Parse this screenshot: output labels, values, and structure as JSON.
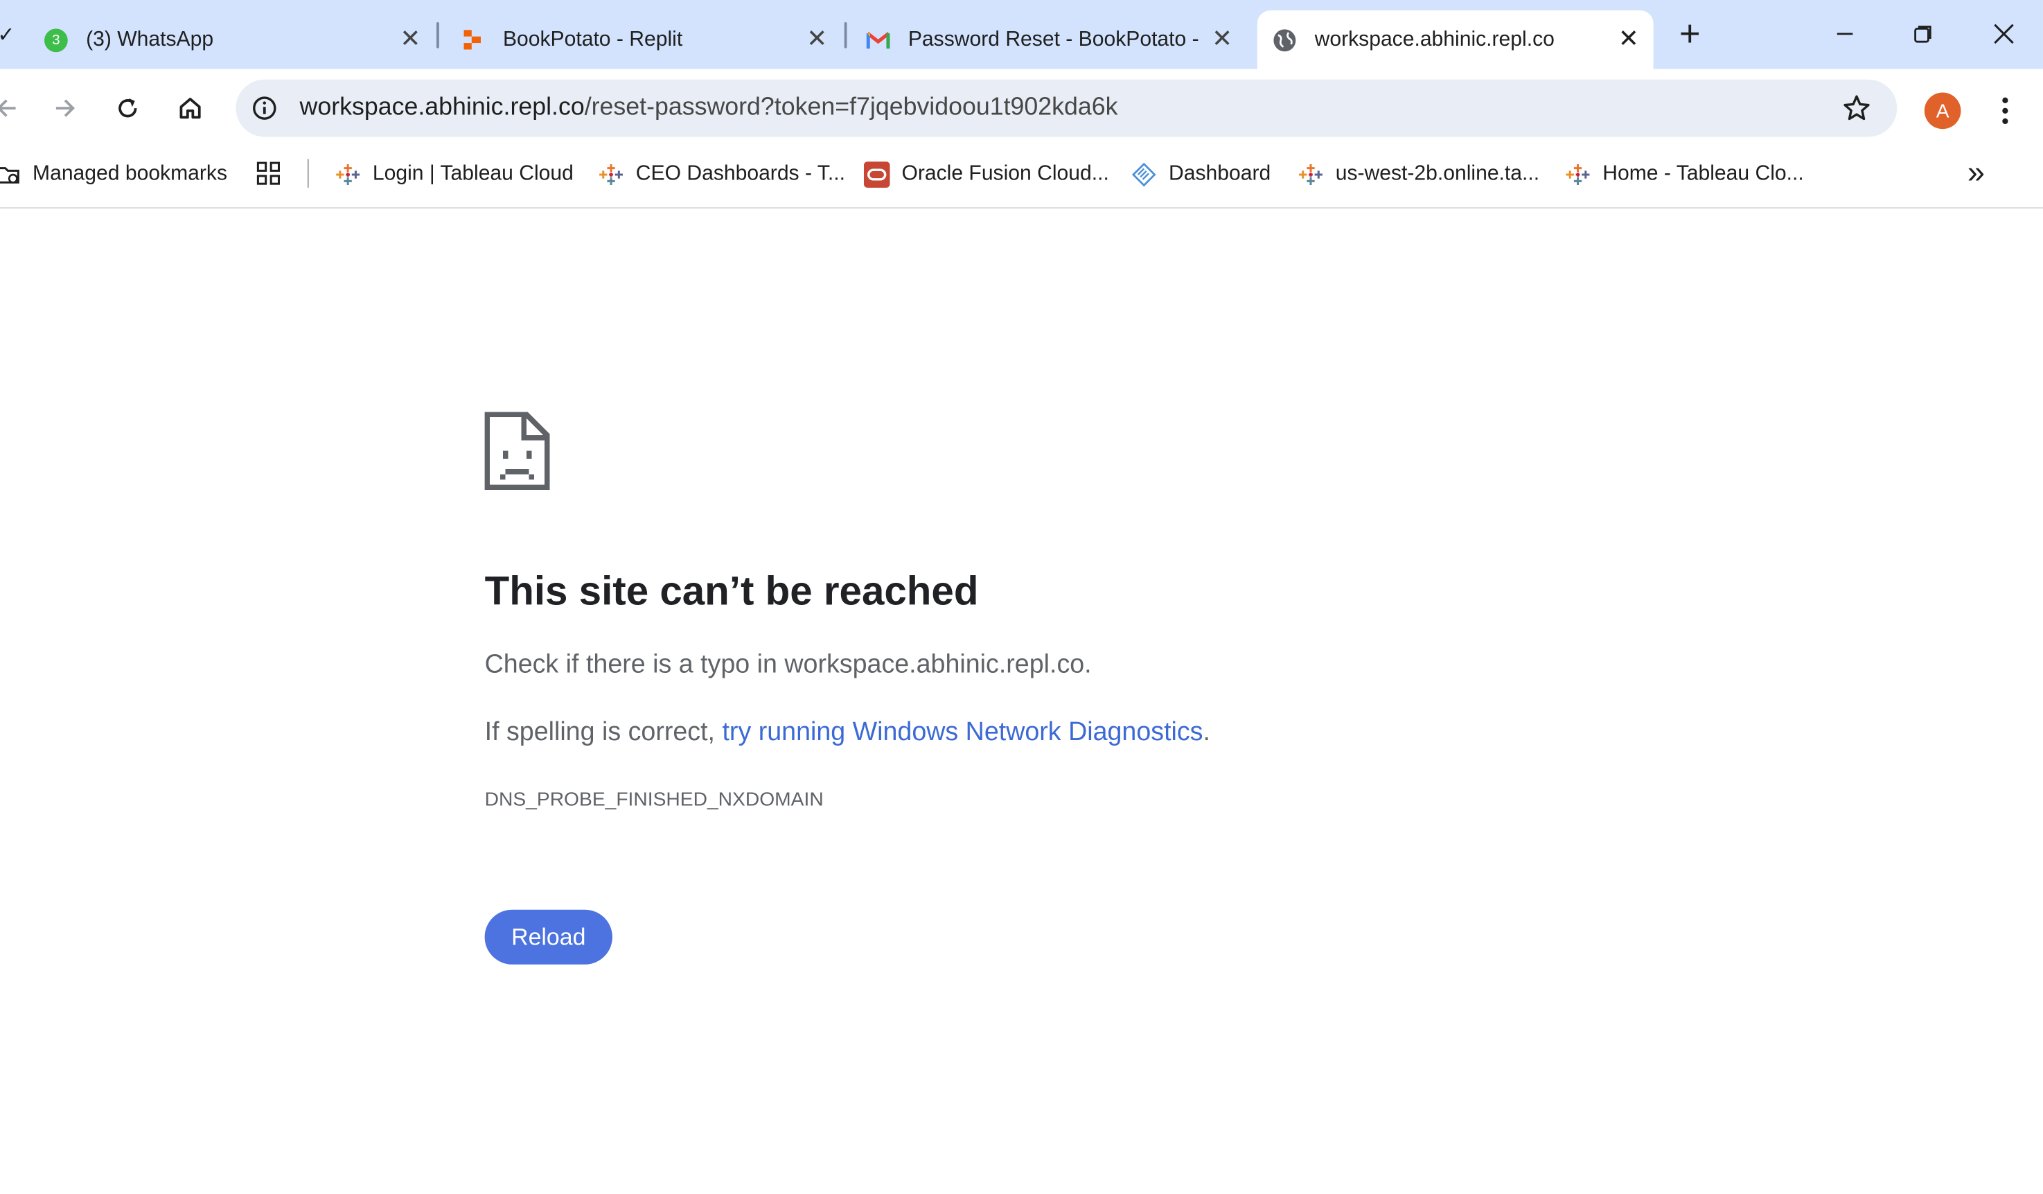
{
  "tabs": [
    {
      "title": "(3) WhatsApp",
      "badge": "3",
      "icon": "whatsapp-icon",
      "active": false
    },
    {
      "title": "BookPotato - Replit",
      "icon": "replit-icon",
      "active": false
    },
    {
      "title": "Password Reset - BookPotato -",
      "icon": "gmail-icon",
      "active": false
    },
    {
      "title": "workspace.abhinic.repl.co",
      "icon": "globe-icon",
      "active": true
    }
  ],
  "tab_close_glyph": "✕",
  "new_tab_glyph": "+",
  "window_controls": {
    "minimize": "minimize-icon",
    "restore": "restore-icon",
    "close": "close-icon"
  },
  "omnibox": {
    "host": "workspace.abhinic.repl.co",
    "path": "/reset-password?token=f7jqebvidoou1t902kda6k"
  },
  "profile": {
    "initial": "A",
    "color": "#e0622a"
  },
  "bookmarks": [
    {
      "label": "Managed bookmarks",
      "icon": "managed-bookmarks-icon"
    },
    {
      "label": "Login | Tableau Cloud",
      "icon": "tableau-icon"
    },
    {
      "label": "CEO Dashboards - T...",
      "icon": "tableau-icon"
    },
    {
      "label": "Oracle Fusion Cloud...",
      "icon": "oracle-icon"
    },
    {
      "label": "Dashboard",
      "icon": "dashboard-icon"
    },
    {
      "label": "us-west-2b.online.ta...",
      "icon": "tableau-icon"
    },
    {
      "label": "Home - Tableau Clo...",
      "icon": "tableau-icon"
    }
  ],
  "overflow_glyph": "»",
  "error": {
    "title": "This site can’t be reached",
    "line1": "Check if there is a typo in workspace.abhinic.repl.co.",
    "line2_prefix": "If spelling is correct, ",
    "line2_link": "try running Windows Network Diagnostics",
    "line2_suffix": ".",
    "code": "DNS_PROBE_FINISHED_NXDOMAIN",
    "reload_label": "Reload"
  },
  "colors": {
    "tabstrip": "#d3e3fd",
    "link": "#3c6ad5",
    "button": "#4c73df"
  }
}
